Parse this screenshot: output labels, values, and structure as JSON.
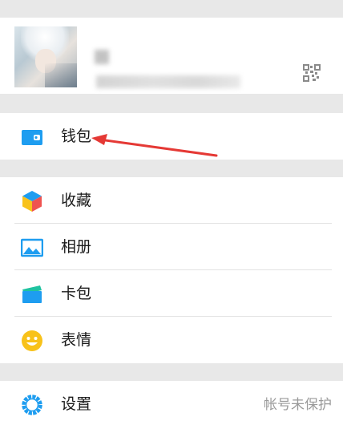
{
  "menu": {
    "wallet_label": "钱包",
    "favorites_label": "收藏",
    "album_label": "相册",
    "cards_label": "卡包",
    "stickers_label": "表情",
    "settings_label": "设置"
  },
  "settings": {
    "security_status": "帐号未保护"
  },
  "icons": {
    "qr": "qr-code-icon",
    "wallet": "wallet-icon",
    "favorites": "favorites-cube-icon",
    "album": "album-image-icon",
    "cards": "card-wallet-icon",
    "stickers": "smiley-icon",
    "settings": "gear-icon"
  },
  "colors": {
    "accent_blue": "#1e9df0",
    "annotation_red": "#e53935",
    "smiley_yellow": "#f8c21a",
    "cards_green": "#1fc3a0"
  }
}
